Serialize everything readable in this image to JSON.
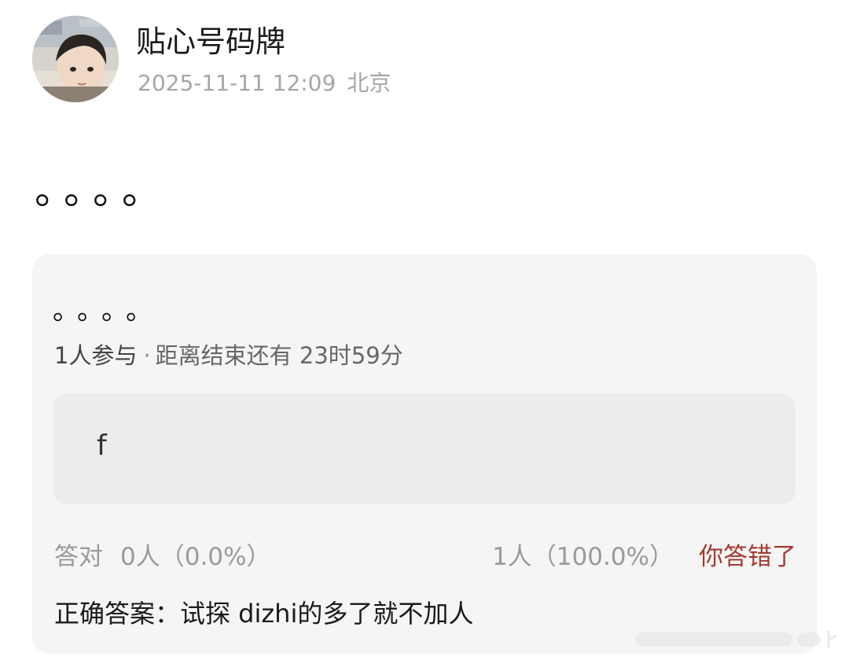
{
  "post": {
    "username": "贴心号码牌",
    "timestamp": "2025-11-11 12:09",
    "location": "北京",
    "text": "。。。。"
  },
  "poll": {
    "title": "。。。。",
    "participants": "1人参与",
    "separator": "·",
    "remaining": "距离结束还有 23时59分",
    "option_label": "f",
    "correct_label": "答对",
    "correct_stats": "0人（0.0%）",
    "wrong_stats": "1人（100.0%）",
    "wrong_status": "你答错了",
    "answer": "正确答案：试探 dizhi的多了就不加人"
  },
  "colors": {
    "wrong_status": "#a33a33",
    "card_bg": "#f5f5f5",
    "option_bg": "#ececec",
    "meta_gray": "#a6a6a6"
  }
}
